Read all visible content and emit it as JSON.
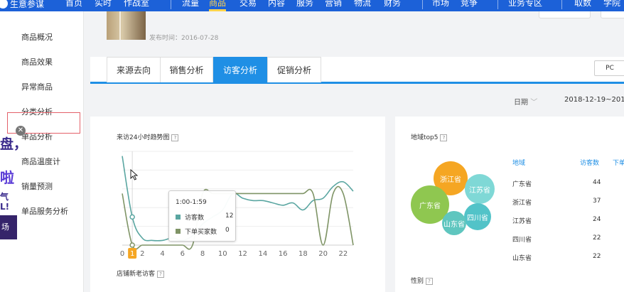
{
  "topnav": {
    "brand": "生意参谋",
    "items": [
      "首页",
      "实时",
      "作战室",
      "流量",
      "商品",
      "交易",
      "内容",
      "服务",
      "营销",
      "物流",
      "财务",
      "市场",
      "竞争",
      "业务专区",
      "取数",
      "学院"
    ],
    "active": "商品"
  },
  "sidebar": {
    "items": [
      "商品概况",
      "商品效果",
      "异常商品",
      "分类分析",
      "单品分析",
      "商品温度计",
      "销量预测",
      "单品服务分析"
    ],
    "active": "单品分析"
  },
  "promo": {
    "text1": "盘，",
    "text2": "啦",
    "text3": "气",
    "text4": "L!",
    "text5": "场"
  },
  "product": {
    "publish_time": "发布时间：2016-07-28"
  },
  "tabs": [
    "来源去向",
    "销售分析",
    "访客分析",
    "促销分析"
  ],
  "active_tab": "访客分析",
  "device_toggle": "PC",
  "date": {
    "label": "日期",
    "range": "2018-12-19~201"
  },
  "trend_panel": {
    "title": "来访24小时趋势图",
    "help": "?"
  },
  "tooltip": {
    "title": "1:00-1:59",
    "rows": [
      {
        "label": "访客数",
        "value": "12",
        "color": "#5aa6a1"
      },
      {
        "label": "下单买家数",
        "value": "0",
        "color": "#7f9466"
      }
    ]
  },
  "region_panel": {
    "title": "地域top5",
    "help": "?",
    "headers": [
      "地域",
      "访客数",
      "下单"
    ],
    "rows": [
      {
        "region": "广东省",
        "visitors": "44"
      },
      {
        "region": "浙江省",
        "visitors": "37"
      },
      {
        "region": "江苏省",
        "visitors": "24"
      },
      {
        "region": "四川省",
        "visitors": "22"
      },
      {
        "region": "山东省",
        "visitors": "22"
      }
    ],
    "bubbles": [
      {
        "label": "浙江省",
        "color": "#f5a623"
      },
      {
        "label": "江苏省",
        "color": "#7fd8d6"
      },
      {
        "label": "广东省",
        "color": "#8fc750"
      },
      {
        "label": "四川省",
        "color": "#52c3c8"
      },
      {
        "label": "山东省",
        "color": "#5fc6bf"
      }
    ]
  },
  "newold_panel": {
    "title": "店铺新老访客",
    "help": "?"
  },
  "gender_panel": {
    "title": "性别",
    "help": "?"
  },
  "chart_data": {
    "type": "line",
    "x_ticks": [
      "0",
      "1",
      "2",
      "4",
      "6",
      "8",
      "10",
      "12",
      "14",
      "16",
      "18",
      "20",
      "22"
    ],
    "highlighted_tick": "1",
    "x": [
      0,
      1,
      2,
      3,
      4,
      5,
      6,
      7,
      8,
      9,
      10,
      11,
      12,
      13,
      14,
      15,
      16,
      17,
      18,
      19,
      20,
      21,
      22,
      23
    ],
    "series": [
      {
        "name": "访客数",
        "color": "#5aa6a1",
        "values": [
          38,
          12,
          3,
          2,
          2,
          3,
          2,
          4,
          9,
          12,
          15,
          22,
          20,
          19,
          19,
          18,
          17,
          18,
          15,
          19,
          20,
          25,
          27,
          23
        ]
      },
      {
        "name": "下单买家数",
        "color": "#7f9466",
        "values": [
          22,
          0,
          0,
          0,
          0,
          0,
          0,
          0,
          22,
          22,
          22,
          22,
          22,
          22,
          22,
          22,
          22,
          22,
          22,
          22,
          0,
          22,
          22,
          0
        ]
      }
    ],
    "ylim": [
      0,
      40
    ],
    "grid": true
  }
}
